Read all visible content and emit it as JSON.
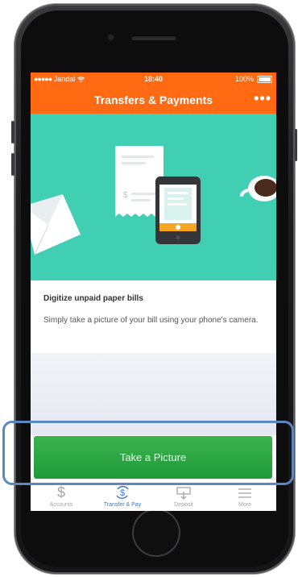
{
  "status_bar": {
    "carrier": "Jandal",
    "time": "18:40",
    "battery": "100%"
  },
  "nav": {
    "title": "Transfers & Payments",
    "more_icon": "•••"
  },
  "card": {
    "headline": "Digitize unpaid paper bills",
    "description": "Simply take a picture of your bill using your phone's camera."
  },
  "cta": {
    "label": "Take a Picture"
  },
  "tabs": [
    {
      "label": "Accounts",
      "icon": "dollar-icon",
      "active": false
    },
    {
      "label": "Transfer & Pay",
      "icon": "transfer-icon",
      "active": true
    },
    {
      "label": "Deposit",
      "icon": "deposit-icon",
      "active": false
    },
    {
      "label": "More",
      "icon": "menu-icon",
      "active": false
    }
  ],
  "colors": {
    "accent": "#ff6a13",
    "hero": "#41cfb4",
    "cta": "#2ba845",
    "tab_active": "#3d78d6",
    "highlight": "#5b87c3"
  }
}
